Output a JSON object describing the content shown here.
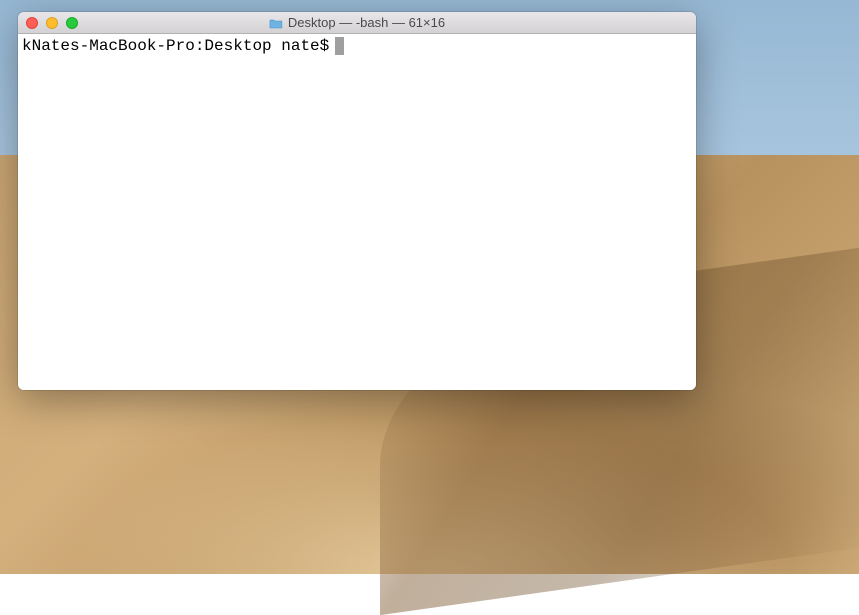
{
  "window": {
    "title": "Desktop — -bash — 61×16"
  },
  "terminal": {
    "prompt": "kNates-MacBook-Pro:Desktop nate$"
  },
  "colors": {
    "close": "#ff5f56",
    "minimize": "#ffbd2e",
    "zoom": "#27c93f"
  }
}
